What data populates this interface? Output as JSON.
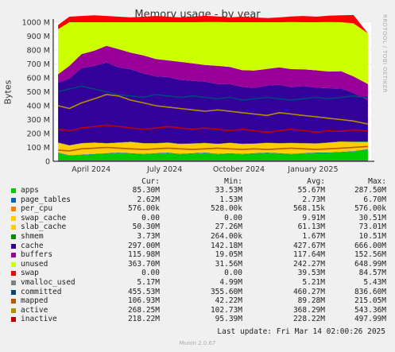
{
  "side_label": "RRDTOOL / TOBI OETIKER",
  "chart_data": {
    "type": "area",
    "title": "Memory usage - by year",
    "ylabel": "Bytes",
    "ylim": [
      0,
      1000000000
    ],
    "yticks": [
      {
        "v": 0,
        "label": "0"
      },
      {
        "v": 100000000,
        "label": "100 M"
      },
      {
        "v": 200000000,
        "label": "200 M"
      },
      {
        "v": 300000000,
        "label": "300 M"
      },
      {
        "v": 400000000,
        "label": "400 M"
      },
      {
        "v": 500000000,
        "label": "500 M"
      },
      {
        "v": 600000000,
        "label": "600 M"
      },
      {
        "v": 700000000,
        "label": "700 M"
      },
      {
        "v": 800000000,
        "label": "800 M"
      },
      {
        "v": 900000000,
        "label": "900 M"
      },
      {
        "v": 1000000000,
        "label": "1000 M"
      }
    ],
    "x_start": "2024-02-14",
    "x_end": "2025-03-14",
    "xticks": [
      {
        "date": "2024-04-01",
        "label": "April 2024"
      },
      {
        "date": "2024-07-01",
        "label": "July 2024"
      },
      {
        "date": "2024-10-01",
        "label": "October 2024"
      },
      {
        "date": "2025-01-01",
        "label": "January 2025"
      }
    ],
    "stack_order": [
      "apps",
      "page_tables",
      "per_cpu",
      "swap_cache",
      "slab_cache",
      "shmem",
      "cache",
      "buffers",
      "unused",
      "swap"
    ],
    "line_order": [
      "vmalloc_used",
      "committed",
      "mapped",
      "active",
      "inactive"
    ],
    "x": [
      "2024-02-20",
      "2024-03-05",
      "2024-03-20",
      "2024-04-05",
      "2024-04-20",
      "2024-05-05",
      "2024-05-20",
      "2024-06-05",
      "2024-06-20",
      "2024-07-05",
      "2024-07-20",
      "2024-08-05",
      "2024-08-20",
      "2024-09-05",
      "2024-09-20",
      "2024-10-05",
      "2024-10-20",
      "2024-11-05",
      "2024-11-20",
      "2024-12-05",
      "2024-12-20",
      "2025-01-05",
      "2025-01-20",
      "2025-02-05",
      "2025-02-20",
      "2025-03-10"
    ],
    "series": [
      {
        "name": "apps",
        "color": "#00cc00",
        "values": [
          60,
          40,
          45,
          50,
          55,
          60,
          55,
          50,
          55,
          60,
          50,
          55,
          60,
          50,
          55,
          50,
          55,
          60,
          55,
          50,
          55,
          60,
          60,
          65,
          70,
          85
        ]
      },
      {
        "name": "page_tables",
        "color": "#0066b3",
        "values": [
          3,
          3,
          3,
          3,
          3,
          3,
          3,
          3,
          3,
          3,
          3,
          3,
          3,
          3,
          3,
          3,
          3,
          3,
          3,
          3,
          3,
          3,
          3,
          3,
          3,
          3
        ]
      },
      {
        "name": "per_cpu",
        "color": "#ff8000",
        "values": [
          1,
          1,
          1,
          1,
          1,
          1,
          1,
          1,
          1,
          1,
          1,
          1,
          1,
          1,
          1,
          1,
          1,
          1,
          1,
          1,
          1,
          1,
          1,
          1,
          1,
          1
        ]
      },
      {
        "name": "swap_cache",
        "color": "#ffcc00",
        "values": [
          10,
          15,
          20,
          10,
          5,
          10,
          15,
          20,
          10,
          5,
          10,
          8,
          12,
          10,
          8,
          10,
          12,
          8,
          10,
          12,
          10,
          8,
          10,
          12,
          10,
          0
        ]
      },
      {
        "name": "slab_cache",
        "color": "#ffcc00",
        "values": [
          60,
          55,
          60,
          70,
          65,
          60,
          65,
          55,
          60,
          65,
          60,
          60,
          55,
          60,
          65,
          60,
          55,
          60,
          60,
          65,
          60,
          55,
          60,
          60,
          55,
          50
        ]
      },
      {
        "name": "shmem",
        "color": "#008f00",
        "values": [
          2,
          2,
          2,
          2,
          2,
          2,
          2,
          2,
          2,
          2,
          2,
          2,
          2,
          2,
          2,
          2,
          2,
          2,
          2,
          2,
          2,
          2,
          2,
          2,
          2,
          4
        ]
      },
      {
        "name": "cache",
        "color": "#330099",
        "values": [
          430,
          480,
          540,
          550,
          580,
          540,
          520,
          500,
          480,
          470,
          460,
          450,
          440,
          430,
          420,
          410,
          400,
          410,
          420,
          400,
          410,
          400,
          390,
          380,
          350,
          297
        ]
      },
      {
        "name": "buffers",
        "color": "#990099",
        "values": [
          60,
          90,
          100,
          110,
          120,
          130,
          120,
          130,
          125,
          120,
          130,
          125,
          120,
          130,
          125,
          120,
          125,
          120,
          125,
          130,
          120,
          125,
          120,
          125,
          120,
          116
        ]
      },
      {
        "name": "unused",
        "color": "#ccff00",
        "values": [
          324,
          314,
          229,
          204,
          169,
          194,
          219,
          239,
          264,
          274,
          284,
          296,
          308,
          316,
          321,
          344,
          347,
          336,
          324,
          338,
          339,
          346,
          356,
          352,
          381,
          364
        ]
      },
      {
        "name": "swap",
        "color": "#ff0000",
        "values": [
          30,
          40,
          45,
          50,
          45,
          40,
          35,
          40,
          45,
          40,
          35,
          40,
          45,
          40,
          35,
          40,
          35,
          30,
          35,
          40,
          45,
          40,
          45,
          50,
          60,
          0
        ]
      },
      {
        "name": "vmalloc_used",
        "color": "#808080",
        "values": [
          5,
          5,
          5,
          5,
          5,
          5,
          5,
          5,
          5,
          5,
          5,
          5,
          5,
          5,
          5,
          5,
          5,
          5,
          5,
          5,
          5,
          5,
          5,
          5,
          5,
          5
        ]
      },
      {
        "name": "committed",
        "color": "#00487d",
        "values": [
          500,
          520,
          540,
          520,
          500,
          480,
          470,
          460,
          480,
          470,
          460,
          470,
          460,
          450,
          460,
          440,
          450,
          460,
          450,
          440,
          450,
          460,
          450,
          460,
          470,
          456
        ]
      },
      {
        "name": "mapped",
        "color": "#b35a00",
        "values": [
          80,
          75,
          90,
          95,
          100,
          95,
          90,
          85,
          90,
          95,
          90,
          85,
          90,
          95,
          90,
          85,
          90,
          85,
          90,
          95,
          90,
          85,
          90,
          95,
          100,
          107
        ]
      },
      {
        "name": "active",
        "color": "#b38f00",
        "values": [
          400,
          380,
          420,
          450,
          480,
          470,
          440,
          420,
          400,
          390,
          380,
          370,
          360,
          370,
          360,
          350,
          340,
          330,
          350,
          340,
          330,
          320,
          310,
          300,
          290,
          268
        ]
      },
      {
        "name": "inactive",
        "color": "#c00000",
        "values": [
          230,
          220,
          240,
          250,
          260,
          250,
          240,
          230,
          240,
          250,
          240,
          230,
          240,
          230,
          220,
          230,
          220,
          210,
          220,
          230,
          220,
          210,
          220,
          215,
          225,
          218
        ]
      }
    ]
  },
  "legend": {
    "headers": [
      "Cur:",
      "Min:",
      "Avg:",
      "Max:"
    ],
    "rows": [
      {
        "name": "apps",
        "color": "#00cc00",
        "cur": "85.30M",
        "min": "33.53M",
        "avg": "55.67M",
        "max": "287.50M"
      },
      {
        "name": "page_tables",
        "color": "#0066b3",
        "cur": "2.62M",
        "min": "1.53M",
        "avg": "2.73M",
        "max": "6.70M"
      },
      {
        "name": "per_cpu",
        "color": "#ff8000",
        "cur": "576.00k",
        "min": "528.00k",
        "avg": "568.15k",
        "max": "576.00k"
      },
      {
        "name": "swap_cache",
        "color": "#ffcc00",
        "cur": "0.00",
        "min": "0.00",
        "avg": "9.91M",
        "max": "30.51M"
      },
      {
        "name": "slab_cache",
        "color": "#ffcc00",
        "cur": "50.30M",
        "min": "27.26M",
        "avg": "61.13M",
        "max": "73.01M"
      },
      {
        "name": "shmem",
        "color": "#008f00",
        "cur": "3.73M",
        "min": "264.00k",
        "avg": "1.67M",
        "max": "10.51M"
      },
      {
        "name": "cache",
        "color": "#330099",
        "cur": "297.00M",
        "min": "142.18M",
        "avg": "427.67M",
        "max": "666.00M"
      },
      {
        "name": "buffers",
        "color": "#990099",
        "cur": "115.98M",
        "min": "19.05M",
        "avg": "117.64M",
        "max": "152.56M"
      },
      {
        "name": "unused",
        "color": "#ccff00",
        "cur": "363.70M",
        "min": "31.56M",
        "avg": "242.27M",
        "max": "648.99M"
      },
      {
        "name": "swap",
        "color": "#ff0000",
        "cur": "0.00",
        "min": "0.00",
        "avg": "39.53M",
        "max": "84.57M"
      },
      {
        "name": "vmalloc_used",
        "color": "#808080",
        "cur": "5.17M",
        "min": "4.99M",
        "avg": "5.21M",
        "max": "5.43M"
      },
      {
        "name": "committed",
        "color": "#00487d",
        "cur": "455.53M",
        "min": "355.60M",
        "avg": "460.27M",
        "max": "836.60M"
      },
      {
        "name": "mapped",
        "color": "#b35a00",
        "cur": "106.93M",
        "min": "42.22M",
        "avg": "89.28M",
        "max": "215.05M"
      },
      {
        "name": "active",
        "color": "#b38f00",
        "cur": "268.25M",
        "min": "102.73M",
        "avg": "368.29M",
        "max": "543.36M"
      },
      {
        "name": "inactive",
        "color": "#c00000",
        "cur": "218.22M",
        "min": "95.39M",
        "avg": "228.22M",
        "max": "497.99M"
      }
    ]
  },
  "last_update": "Last update: Fri Mar 14 02:00:26 2025",
  "footer": "Munin 2.0.67"
}
